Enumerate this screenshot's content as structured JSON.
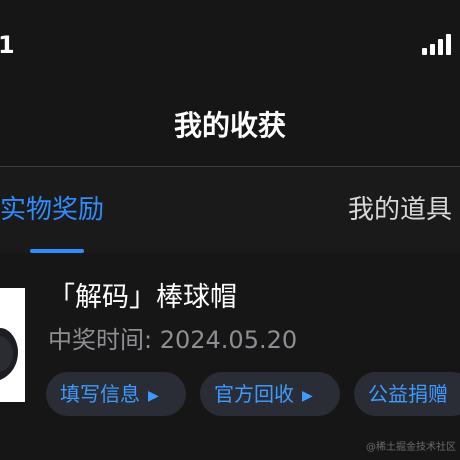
{
  "status_bar": {
    "time_fragment": "1"
  },
  "header": {
    "title": "我的收获"
  },
  "tabs": [
    {
      "label": "实物奖励",
      "active": true
    },
    {
      "label": "我的道具",
      "active": false
    }
  ],
  "colors": {
    "accent": "#2f8cff",
    "background": "#161616"
  },
  "item": {
    "name": "「解码」棒球帽",
    "date": "中奖时间: 2024.05.20",
    "actions": [
      {
        "label": "填写信息",
        "icon": "play-arrow-icon"
      },
      {
        "label": "官方回收",
        "icon": "play-arrow-icon"
      },
      {
        "label": "公益捐赠"
      }
    ]
  },
  "watermark": "@稀土掘金技术社区"
}
